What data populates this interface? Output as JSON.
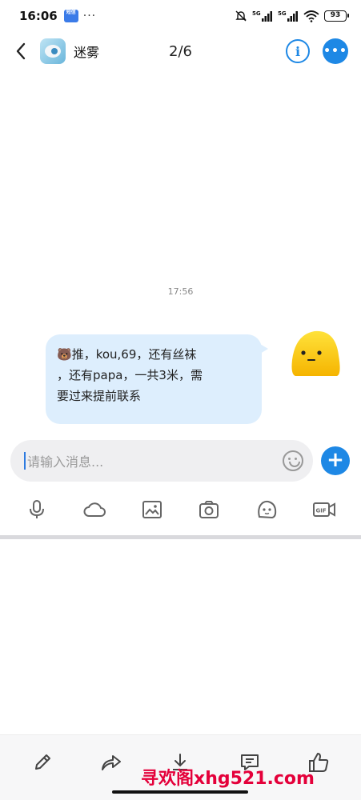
{
  "status_bar": {
    "time": "16:06",
    "app_badge": "短信",
    "dots": "···",
    "signal_1": "5G",
    "signal_2": "5G",
    "battery": "93"
  },
  "header": {
    "chat_name": "迷雾",
    "page_indicator": "2/6"
  },
  "chat": {
    "timestamp": "17:56",
    "message": {
      "emoji": "🐻",
      "line1": "推，kou,69，还有丝袜",
      "line2": "，还有papa，一共3米，需",
      "line3": "要过来提前联系"
    }
  },
  "input": {
    "placeholder": "请输入消息..."
  },
  "toolbar": {
    "icons": [
      "microphone-icon",
      "cloud-icon",
      "image-icon",
      "camera-icon",
      "emoji-icon",
      "gif-icon"
    ],
    "gif_label": "GIF"
  },
  "bottom_bar": {
    "icons": [
      "edit-icon",
      "share-icon",
      "download-icon",
      "comment-icon",
      "thumbs-up-icon"
    ]
  },
  "watermark": "寻欢阁xhg521.com",
  "colors": {
    "accent": "#1e88e5",
    "bubble": "#ddeefd",
    "watermark": "#e4003a"
  }
}
